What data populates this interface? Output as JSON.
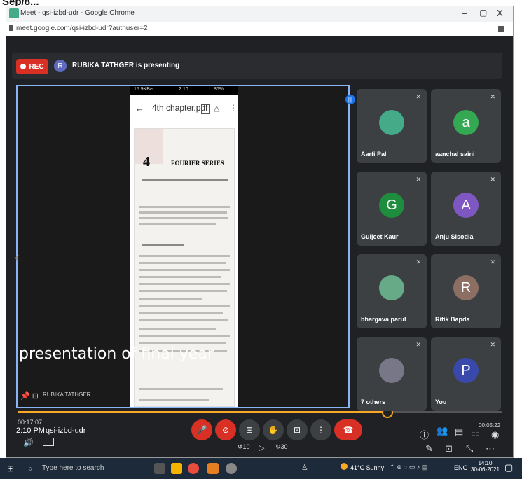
{
  "page_label": "Sep/8...",
  "window": {
    "title": "Meet - qsi-izbd-udr - Google Chrome",
    "minimize": "–",
    "maximize": "▢",
    "close": "X",
    "url": "meet.google.com/qsi-izbd-udr?authuser=2"
  },
  "meet": {
    "rec_label": "REC",
    "presenter_initial": "R",
    "presenting_text": "RUBIKA TATHGER is presenting",
    "presentation": {
      "status_left": "15.9KB/s",
      "status_time": "2:10",
      "status_battery": "86%",
      "pdf_title": "4th chapter.pdf",
      "chapter_number": "4",
      "chapter_title": "FOURIER SERIES",
      "caption": "presentation of final year",
      "presenter_name": "RUBIKA TATHGER"
    },
    "participants": [
      {
        "name": "Aarti Pal",
        "initial": "",
        "color": "#4a8"
      },
      {
        "name": "aanchal saini",
        "initial": "a",
        "color": "#34a853"
      },
      {
        "name": "Guljeet Kaur",
        "initial": "G",
        "color": "#1e8e3e"
      },
      {
        "name": "Anju Sisodia",
        "initial": "A",
        "color": "#7e57c2"
      },
      {
        "name": "bhargava parul",
        "initial": "",
        "color": "#6a8"
      },
      {
        "name": "Ritik Bapda",
        "initial": "R",
        "color": "#8d6e63"
      },
      {
        "name": "7 others",
        "initial": "",
        "color": "#778"
      },
      {
        "name": "You",
        "initial": "P",
        "color": "#3949ab"
      }
    ],
    "progress_fraction": 0.76,
    "time_elapsed": "00:17:07",
    "clock": "2:10 PM",
    "meeting_code": "qsi-izbd-udr",
    "time_total": "00:05:22",
    "skip_back": "10",
    "skip_forward": "30"
  },
  "taskbar": {
    "search_placeholder": "Type here to search",
    "weather": "41°C Sunny",
    "lang": "ENG",
    "time": "14:10",
    "date": "30-06-2021"
  },
  "colors": {
    "meet_bg": "#202124",
    "tile_bg": "#3c4043",
    "accent": "#8ab4f8",
    "rec": "#d93025",
    "end_call": "#d93025",
    "progress": "#f9a825"
  }
}
